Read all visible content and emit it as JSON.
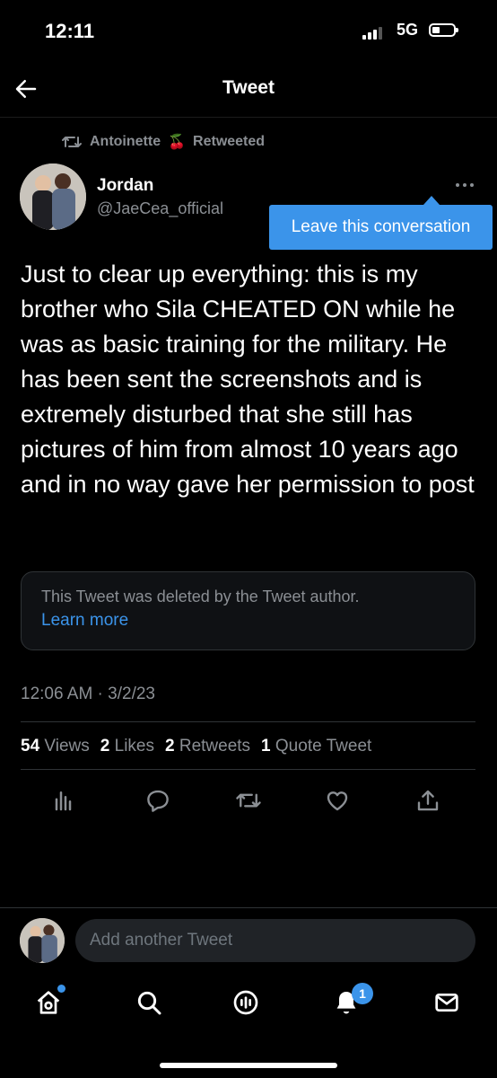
{
  "status_bar": {
    "time": "12:11",
    "network": "5G"
  },
  "header": {
    "title": "Tweet"
  },
  "retweet_context": {
    "user": "Antoinette",
    "emoji": "🍒",
    "label": "Retweeted"
  },
  "tweet": {
    "author_name": "Jordan",
    "author_handle": "@JaeCea_official",
    "body": "Just to clear up everything: this is my brother who Sila CHEATED ON while he was as basic training for the military. He has been sent the screenshots and is extremely disturbed that she still has pictures of him from almost 10 years ago and in no way gave her permission to post",
    "deleted_notice": "This Tweet was deleted by the Tweet author.",
    "learn_more": "Learn more",
    "timestamp": "12:06 AM · 3/2/23",
    "stats": {
      "views_count": "54",
      "views_label": "Views",
      "likes_count": "2",
      "likes_label": "Likes",
      "retweets_count": "2",
      "retweets_label": "Retweets",
      "quotes_count": "1",
      "quotes_label": "Quote Tweet"
    }
  },
  "tooltip": {
    "text": "Leave this conversation"
  },
  "compose": {
    "placeholder": "Add another Tweet"
  },
  "tab_bar": {
    "notification_count": "1"
  },
  "colors": {
    "accent": "#3b94ea",
    "background": "#000000",
    "muted": "#8b8f94"
  },
  "icons": [
    "back-arrow-icon",
    "retweet-icon",
    "more-icon",
    "views-icon",
    "reply-icon",
    "like-icon",
    "share-icon",
    "home-icon",
    "search-icon",
    "spaces-icon",
    "notifications-icon",
    "messages-icon"
  ]
}
